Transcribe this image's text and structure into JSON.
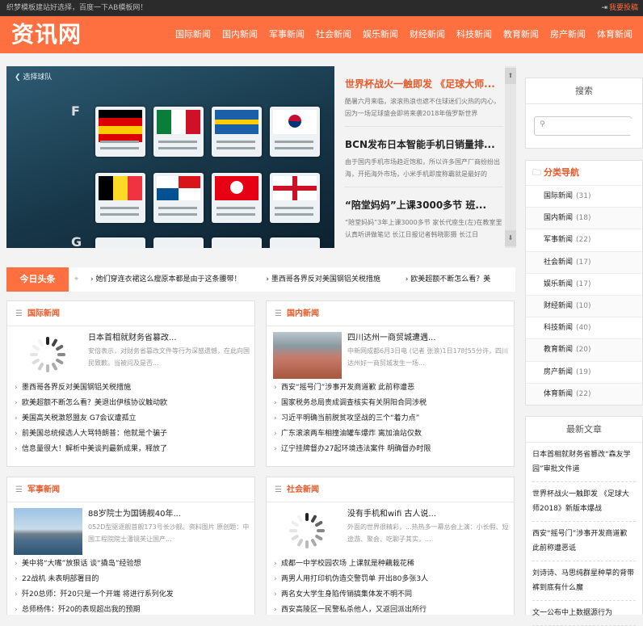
{
  "topbar": {
    "left_text": "织梦模板建站好选择，百度一下AB模板网！",
    "post_label": "我要投稿"
  },
  "header": {
    "logo": "资讯网",
    "nav": [
      "国际新闻",
      "国内新闻",
      "军事新闻",
      "社会新闻",
      "娱乐新闻",
      "财经新闻",
      "科技新闻",
      "教育新闻",
      "房产新闻",
      "体育新闻"
    ]
  },
  "slider": {
    "back_label": "选择球队",
    "group_letters": [
      "F",
      "G"
    ]
  },
  "headlines": [
    {
      "title": "世界杯战火一触即发 《足球大师...",
      "desc": "酷暑六月来临，滚滚热浪也遮不住球迷们火热的内心，因为一场足球盛会即将来袭2018年俄罗斯世界"
    },
    {
      "title": "BCN发布日本智能手机日销量排...",
      "desc": "由于国内手机市场趋近饱和，所以许多国产厂商纷纷出海，开拓海外市场，小米手机即度称霸就是最好的"
    },
    {
      "title": "“陪堂妈妈”上课3000多节 班...",
      "desc": "“陪堂妈妈”3年上课3000多节 家长代座生(左)在教室里认真听讲做笔记 长江日报记者韩晓影摄 长江日"
    }
  ],
  "ticker": {
    "tag": "今日头条",
    "items": [
      "她们穿连衣裙这么瘦原本都是由于这条腰带！",
      "墨西哥各界反对美国钢铝关税措施",
      "欧美超额不断怎么看？美"
    ]
  },
  "boxes": [
    {
      "title": "国际新闻",
      "feat_title": "日本首相就财务省篡改...",
      "feat_desc": "安倍表示，对财务省篡改文件等行为深感遗憾，在此向国民致歉。当被问及是否...",
      "items": [
        "墨西哥各界反对美国钢铝关税措施",
        "欧美超额不断怎么看？美退出伊核协议触动欧",
        "美国高关税激怒盟友 G7会议遭孤立",
        "前美国总统候选人大骂特朗普：他就是个骗子",
        "信息量很大！解析中美谈判最新成果，释放了"
      ]
    },
    {
      "title": "国内新闻",
      "feat_title": "四川达州一商贸城遭遇...",
      "feat_desc": "中新网成都6月3日电 (记者 张浪)1日17时55分许，四川达州好一商贸城发生一场...",
      "items": [
        "西安“摇号门”涉事开发商道歉 此前称遭恶",
        "国家税务总局责成调查核实有关阴阳合同涉税",
        "习近平明确当前脱贫攻坚战的三个“着力点”",
        "广东滚滚两车相撞油罐车爆炸 离加油站仅数",
        "辽宁挂牌督办27起环境违法案件 明确督办时限"
      ]
    },
    {
      "title": "军事新闻",
      "feat_title": "88岁院士为国铸舰40年...",
      "feat_desc": "052D型驱逐舰首舰173号长沙舰。资料图片 原创题：中国工程院院士潘镜芙让国产...",
      "items": [
        "美中将“大嘴”放狠话 谈“撬岛”经验想",
        "22战机 未表明部署目的",
        "歼20总师：歼20只是一个开端 将进行系列化发",
        "总师杨伟：歼20的表现超出我的预期"
      ]
    },
    {
      "title": "社会新闻",
      "feat_title": "没有手机和wifi 古人说...",
      "feat_desc": "外面的世界很精彩，...热热多一幕总会上演：小长假、短途游、聚会、吃聊子其实，...",
      "items": [
        "成都一中学校园农场 上课就是种藕栽花稀",
        "两男人用打印机伪造交警罚单 开出80多张3人",
        "两名女大学生身陷传销搞集体发不明不同",
        "西安高陵区一民警私杀他人，又返回派出所行"
      ]
    }
  ],
  "sidebar": {
    "search_title": "搜索",
    "search_placeholder": "",
    "cat_title": "分类导航",
    "categories": [
      {
        "name": "国际新闻",
        "count": "(31)"
      },
      {
        "name": "国内新闻",
        "count": "(18)"
      },
      {
        "name": "军事新闻",
        "count": "(22)"
      },
      {
        "name": "社会新闻",
        "count": "(17)"
      },
      {
        "name": "娱乐新闻",
        "count": "(17)"
      },
      {
        "name": "财经新闻",
        "count": "(10)"
      },
      {
        "name": "科技新闻",
        "count": "(40)"
      },
      {
        "name": "教育新闻",
        "count": "(20)"
      },
      {
        "name": "房产新闻",
        "count": "(19)"
      },
      {
        "name": "体育新闻",
        "count": "(22)"
      }
    ],
    "latest_title": "最新文章",
    "latest": [
      "日本首相就财务省篡改“森友学园”审批文件道",
      "世界杯战火一触即发 《足球大师2018》新版本爆战",
      "西安“摇号门”涉事开发商道歉 此前称遭恶诋",
      "刘诗诗、马思纯群星种草的背带裤到底有什么魔",
      "文一公布中上数据源行为"
    ]
  },
  "colors": {
    "accent": "#ff7041",
    "topbar": "#2b2b2b",
    "link_red": "#e85a2a"
  }
}
